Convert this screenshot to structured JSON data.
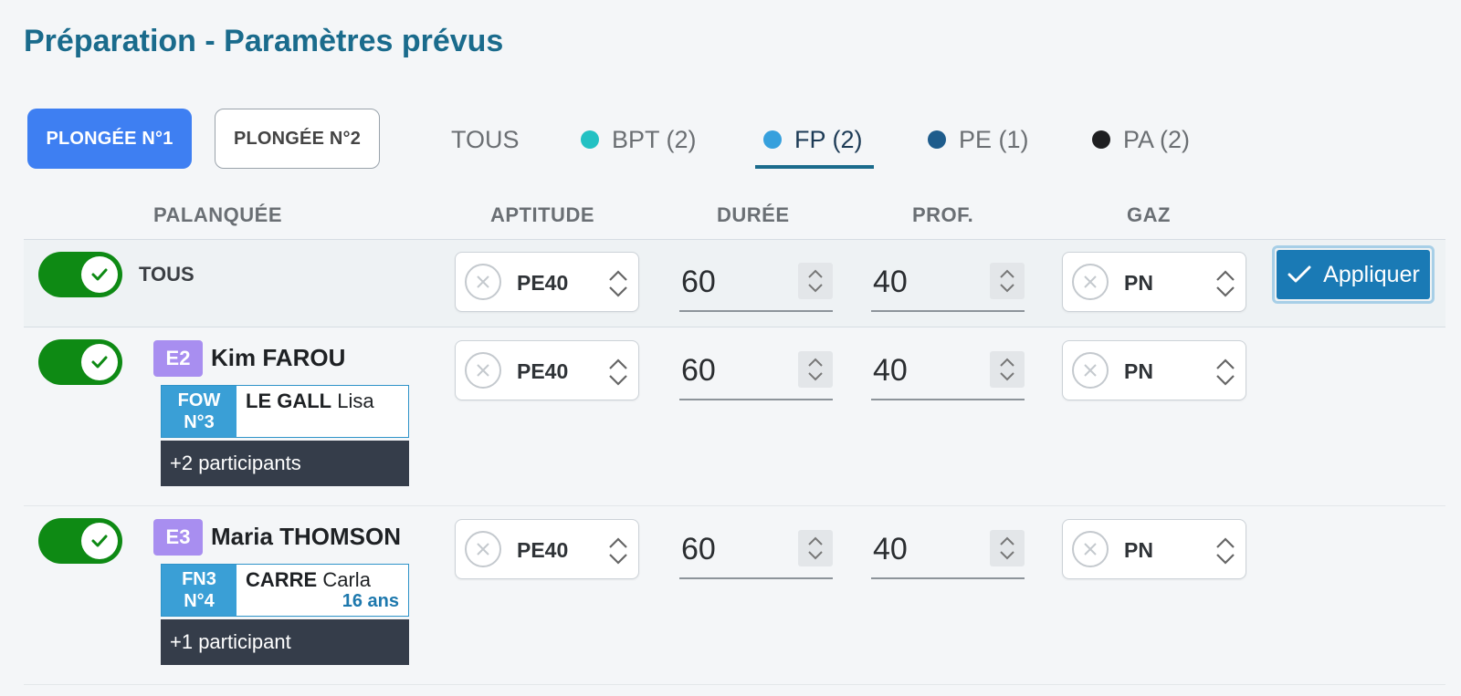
{
  "title": "Préparation - Paramètres prévus",
  "dives": [
    {
      "label": "PLONGÉE N°1",
      "active": true
    },
    {
      "label": "PLONGÉE N°2",
      "active": false
    }
  ],
  "tabs": [
    {
      "label": "TOUS",
      "dot": null
    },
    {
      "label": "BPT (2)",
      "dot": "#22c1c3"
    },
    {
      "label": "FP (2)",
      "dot": "#36a0dd",
      "active": true
    },
    {
      "label": "PE (1)",
      "dot": "#1e5c8c"
    },
    {
      "label": "PA (2)",
      "dot": "#1e1f21"
    }
  ],
  "columns": {
    "palanquee": "PALANQUÉE",
    "aptitude": "APTITUDE",
    "duree": "DURÉE",
    "prof": "PROF.",
    "gaz": "GAZ"
  },
  "all_row": {
    "label": "TOUS",
    "aptitude": "PE40",
    "duree": "60",
    "prof": "40",
    "gaz": "PN",
    "apply_label": "Appliquer"
  },
  "rows": [
    {
      "level": "E2",
      "name": "Kim FAROU",
      "buddy_level": "FOW",
      "buddy_num": "N°3",
      "buddy_last": "LE GALL",
      "buddy_first": "Lisa",
      "buddy_age": "",
      "more": "+2 participants",
      "aptitude": "PE40",
      "duree": "60",
      "prof": "40",
      "gaz": "PN"
    },
    {
      "level": "E3",
      "name": "Maria THOMSON",
      "buddy_level": "FN3",
      "buddy_num": "N°4",
      "buddy_last": "CARRE",
      "buddy_first": "Carla",
      "buddy_age": "16 ans",
      "more": "+1 participant",
      "aptitude": "PE40",
      "duree": "60",
      "prof": "40",
      "gaz": "PN"
    }
  ],
  "colors": {
    "title": "#1a6b8c",
    "primary": "#3e7ff2",
    "toggle_on": "#0e8a14",
    "apply": "#1a7ab5",
    "level_badge": "#a88ef0",
    "buddy_level": "#3a9fd6"
  },
  "icons": {
    "clear": "circle-x-icon",
    "spinner": "chevron-up-down-icon",
    "check": "check-icon"
  }
}
